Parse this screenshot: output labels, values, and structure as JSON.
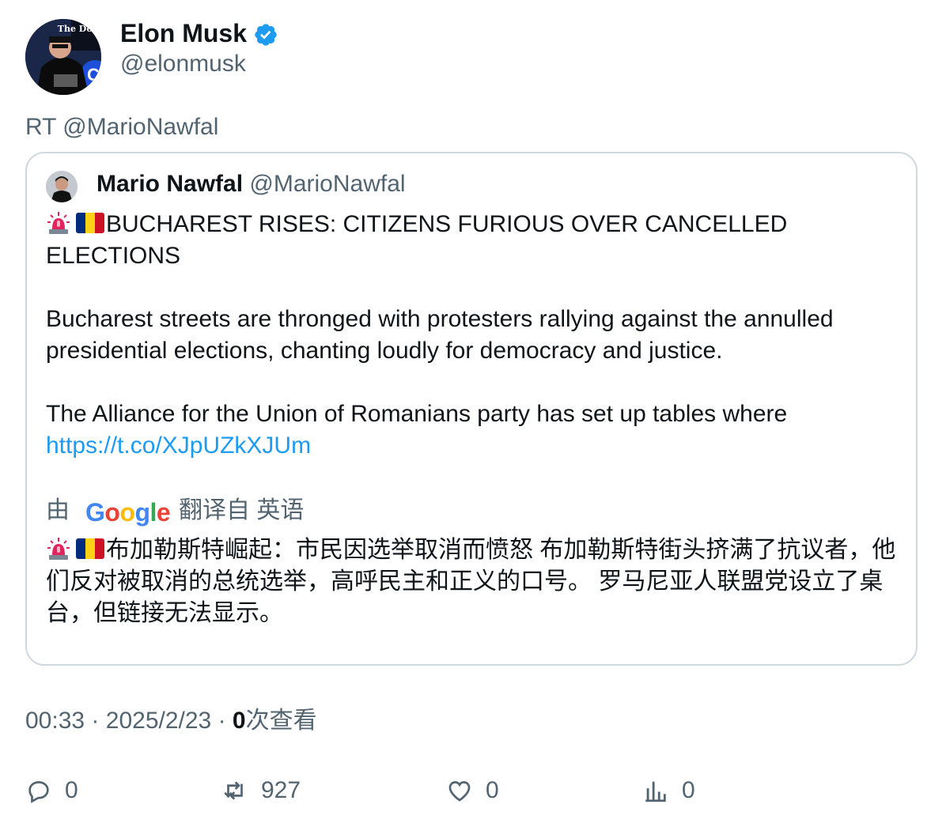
{
  "author": {
    "name": "Elon Musk",
    "handle": "@elonmusk",
    "avatar_text": "The Dogefa",
    "avatar_letter": "C"
  },
  "retweet_line": "RT @MarioNawfal",
  "quoted": {
    "name": "Mario Nawfal",
    "handle": "@MarioNawfal",
    "headline": "BUCHAREST RISES: CITIZENS FURIOUS OVER CANCELLED ELECTIONS",
    "paragraph1": "Bucharest streets are thronged with protesters rallying against the annulled presidential elections, chanting loudly for democracy and justice.",
    "paragraph2": "The Alliance for the Union of Romanians party has set up tables where",
    "link": "https://t.co/XJpUZkXJUm",
    "translation": {
      "by_label": "由",
      "provider": "Google",
      "from_label": "翻译自 英语",
      "text": "布加勒斯特崛起：市民因选举取消而愤怒 布加勒斯特街头挤满了抗议者，他们反对被取消的总统选举，高呼民主和正义的口号。 罗马尼亚人联盟党设立了桌台，但链接无法显示。"
    }
  },
  "meta": {
    "time": "00:33",
    "date": "2025/2/23",
    "views_count": "0",
    "views_label": "次查看"
  },
  "actions": {
    "replies": "0",
    "retweets": "927",
    "likes": "0",
    "views": "0"
  },
  "colors": {
    "accent": "#1d9bf0",
    "muted": "#536471",
    "border": "#cfd9de",
    "flag": [
      "#002b7f",
      "#fcd116",
      "#ce1126"
    ]
  }
}
